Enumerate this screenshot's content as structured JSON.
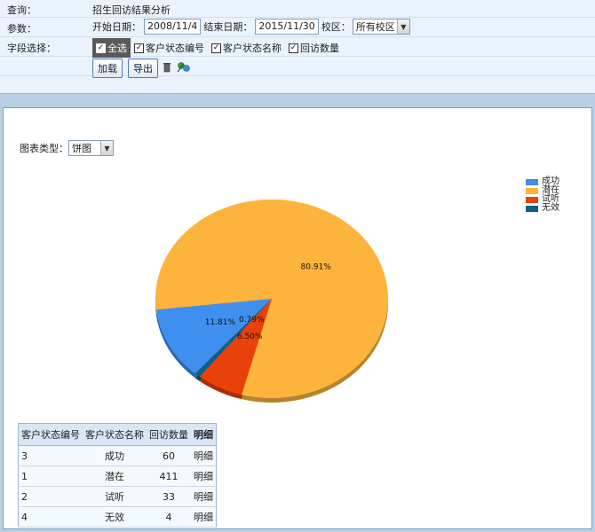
{
  "query": {
    "label": "查询：",
    "value": "招生回访结果分析"
  },
  "params": {
    "label": "参数：",
    "start_label": "开始日期：",
    "start_value": "2008/11/4",
    "end_label": "结束日期：",
    "end_value": "2015/11/30",
    "campus_label": "校区：",
    "campus_value": "所有校区"
  },
  "fields": {
    "label": "字段选择：",
    "select_all": "全选",
    "items": [
      "客户状态编号",
      "客户状态名称",
      "回访数量"
    ]
  },
  "toolbar": {
    "load_label": "加载",
    "export_label": "导出"
  },
  "chart_type": {
    "label": "图表类型：",
    "value": "饼图"
  },
  "chart_data": {
    "type": "pie",
    "categories": [
      "成功",
      "潜在",
      "试听",
      "无效"
    ],
    "values": [
      60,
      411,
      33,
      4
    ],
    "percent_labels": [
      "11.81%",
      "80.91%",
      "6.50%",
      "0.79%"
    ],
    "colors": [
      "#3f8fef",
      "#fdb43c",
      "#e8420a",
      "#0e5e85"
    ],
    "legend_position": "top-right"
  },
  "table": {
    "headers": [
      "客户状态编号",
      "客户状态名称",
      "回访数量",
      "明细"
    ],
    "rows": [
      {
        "id": "3",
        "name": "成功",
        "count": "60",
        "detail": "明细"
      },
      {
        "id": "1",
        "name": "潜在",
        "count": "411",
        "detail": "明细"
      },
      {
        "id": "2",
        "name": "试听",
        "count": "33",
        "detail": "明细"
      },
      {
        "id": "4",
        "name": "无效",
        "count": "4",
        "detail": "明细"
      }
    ]
  }
}
